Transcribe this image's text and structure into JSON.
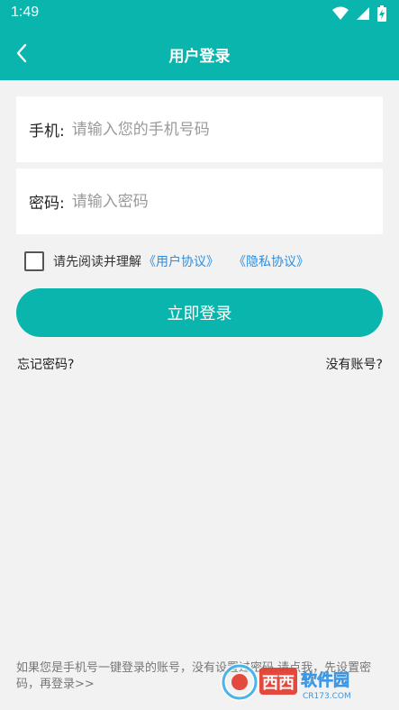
{
  "status_bar": {
    "time": "1:49",
    "icons": [
      "wifi-icon",
      "signal-icon",
      "battery-charging-icon"
    ]
  },
  "header": {
    "title": "用户登录",
    "back_icon": "chevron-left-icon"
  },
  "phone_field": {
    "label": "手机:",
    "placeholder": "请输入您的手机号码",
    "value": ""
  },
  "password_field": {
    "label": "密码:",
    "placeholder": "请输入密码",
    "value": ""
  },
  "agreement": {
    "checked": false,
    "prefix": "请先阅读并理解",
    "user_agreement": "《用户协议》",
    "privacy_agreement": "《隐私协议》"
  },
  "login_button": {
    "label": "立即登录"
  },
  "links": {
    "forgot_password": "忘记密码?",
    "no_account": "没有账号?"
  },
  "footer": {
    "note": "如果您是手机号一键登录的账号，没有设置过密码,请点我，先设置密码，再登录>>"
  },
  "watermark": {
    "brand": "西西软件园",
    "domain": "CR173.COM"
  },
  "colors": {
    "primary": "#09b5ad",
    "link": "#2d8ee0",
    "background": "#f2f2f2"
  }
}
